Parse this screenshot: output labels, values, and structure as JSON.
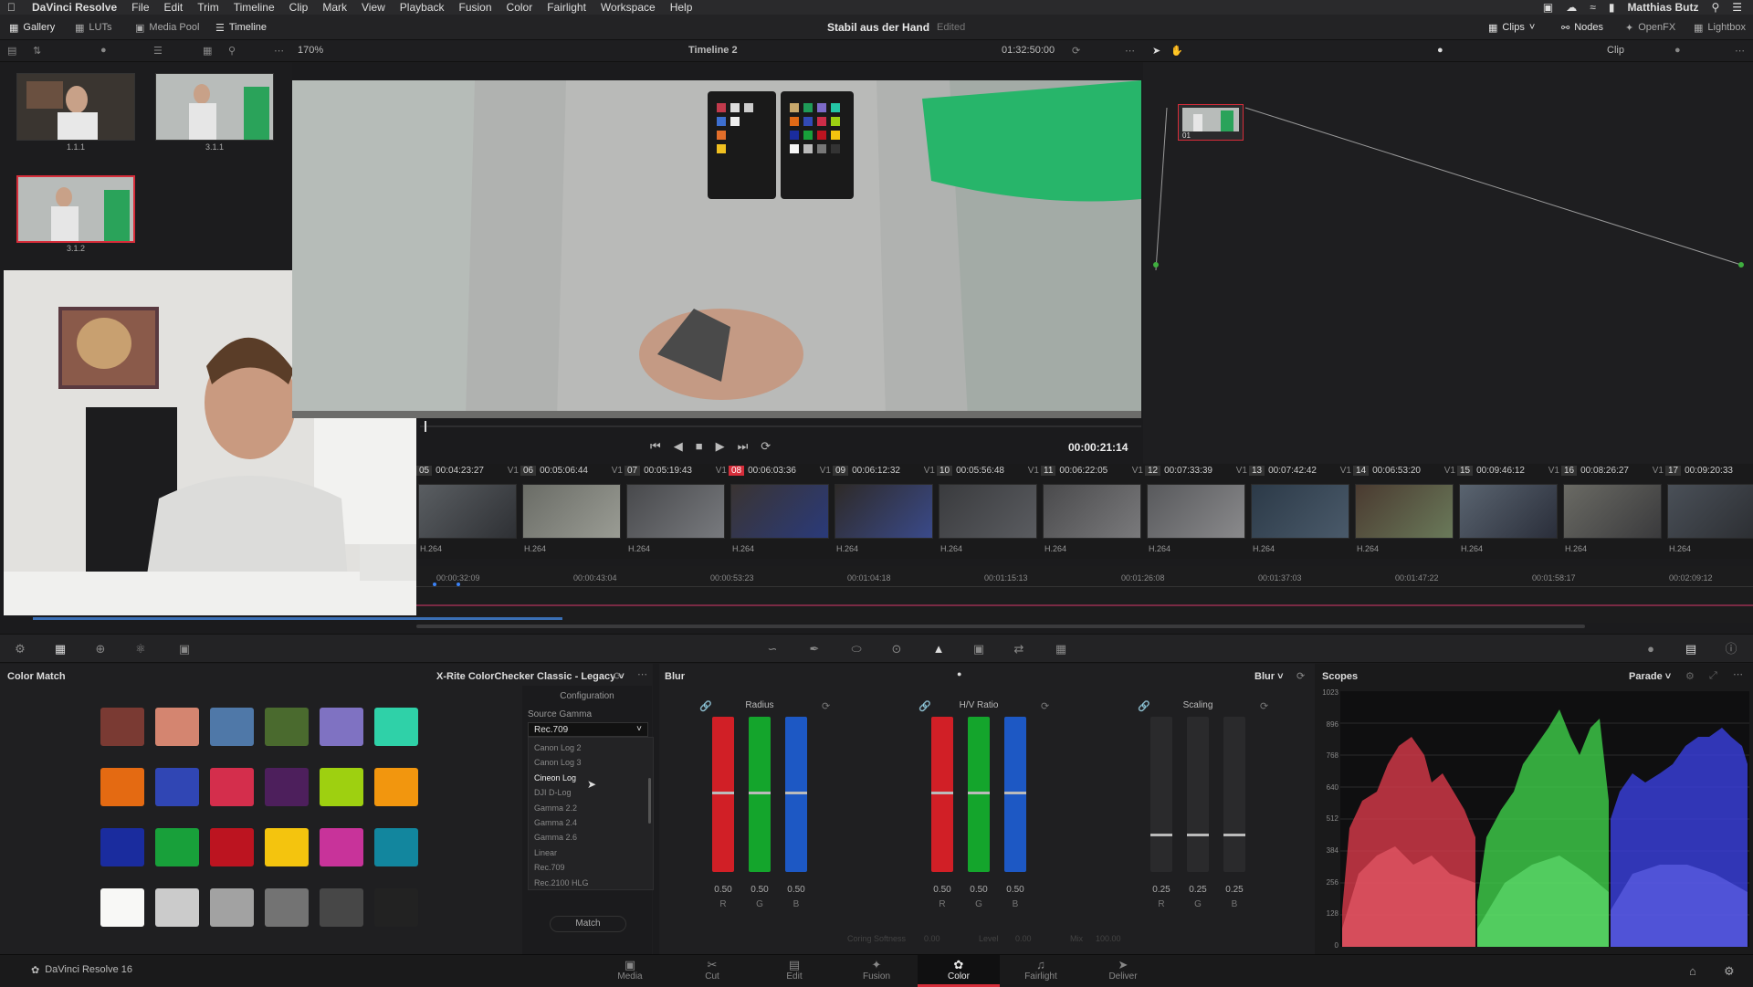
{
  "menubar": {
    "app": "DaVinci Resolve",
    "items": [
      "File",
      "Edit",
      "Trim",
      "Timeline",
      "Clip",
      "Mark",
      "View",
      "Playback",
      "Fusion",
      "Color",
      "Fairlight",
      "Workspace",
      "Help"
    ],
    "user": "Matthias Butz"
  },
  "toolbar": {
    "gallery": "Gallery",
    "luts": "LUTs",
    "media_pool": "Media Pool",
    "timeline": "Timeline",
    "project_title": "Stabil aus der Hand",
    "project_state": "Edited",
    "clips": "Clips",
    "nodes": "Nodes",
    "openfx": "OpenFX",
    "lightbox": "Lightbox"
  },
  "viewer": {
    "zoom": "170%",
    "timeline_name": "Timeline 2",
    "timecode_top": "01:32:50:00",
    "mode": "Clip",
    "timecode_current": "00:00:21:14"
  },
  "gallery": {
    "stills": [
      {
        "label": "1.1.1"
      },
      {
        "label": "3.1.1"
      },
      {
        "label": "3.1.2"
      }
    ]
  },
  "node_editor": {
    "node_label": "01"
  },
  "clips": [
    {
      "num": "05",
      "tc": "00:04:23:27",
      "track": "V1",
      "codec": "H.264"
    },
    {
      "num": "06",
      "tc": "00:05:06:44",
      "track": "V1",
      "codec": "H.264"
    },
    {
      "num": "07",
      "tc": "00:05:19:43",
      "track": "V1",
      "codec": "H.264"
    },
    {
      "num": "08",
      "tc": "00:06:03:36",
      "track": "V1",
      "codec": "H.264"
    },
    {
      "num": "09",
      "tc": "00:06:12:32",
      "track": "V1",
      "codec": "H.264"
    },
    {
      "num": "10",
      "tc": "00:05:56:48",
      "track": "V1",
      "codec": "H.264"
    },
    {
      "num": "11",
      "tc": "00:06:22:05",
      "track": "V1",
      "codec": "H.264"
    },
    {
      "num": "12",
      "tc": "00:07:33:39",
      "track": "V1",
      "codec": "H.264"
    },
    {
      "num": "13",
      "tc": "00:07:42:42",
      "track": "V1",
      "codec": "H.264"
    },
    {
      "num": "14",
      "tc": "00:06:53:20",
      "track": "V1",
      "codec": "H.264"
    },
    {
      "num": "15",
      "tc": "00:09:46:12",
      "track": "V1",
      "codec": "H.264"
    },
    {
      "num": "16",
      "tc": "00:08:26:27",
      "track": "V1",
      "codec": "H.264"
    },
    {
      "num": "17",
      "tc": "00:09:20:33",
      "track": "V1",
      "codec": "H.264"
    }
  ],
  "ruler": [
    "00:00:32:09",
    "00:00:43:04",
    "00:00:53:23",
    "00:01:04:18",
    "00:01:15:13",
    "00:01:26:08",
    "00:01:37:03",
    "00:01:47:22",
    "00:01:58:17",
    "00:02:09:12"
  ],
  "color_match": {
    "title": "Color Match",
    "chart": "X-Rite ColorChecker Classic - Legacy",
    "swatches": [
      [
        "#7a3a33",
        "#d48570",
        "#4f78a8",
        "#4a6a2e",
        "#7f72c2",
        "#2fd1a8"
      ],
      [
        "#e46a12",
        "#3046b4",
        "#d42e4c",
        "#4d1f5c",
        "#9ed010",
        "#f2960e"
      ],
      [
        "#1a2c9e",
        "#18a03a",
        "#bc1420",
        "#f4c40e",
        "#c8339a",
        "#12869e"
      ],
      [
        "#f8f8f6",
        "#cbcbcb",
        "#a2a2a2",
        "#737373",
        "#474747",
        "#222222"
      ]
    ],
    "config_label": "Configuration",
    "source_gamma_label": "Source Gamma",
    "source_gamma_value": "Rec.709",
    "gamma_options": [
      "Canon Log 2",
      "Canon Log 3",
      "Cineon Log",
      "DJI D-Log",
      "Gamma 2.2",
      "Gamma 2.4",
      "Gamma 2.6",
      "Linear",
      "Rec.709",
      "Rec.2100 HLG"
    ],
    "match_button": "Match"
  },
  "blur": {
    "title": "Blur",
    "mode": "Blur",
    "radius_label": "Radius",
    "hv_label": "H/V Ratio",
    "scaling_label": "Scaling",
    "radius_values": [
      "0.50",
      "0.50",
      "0.50"
    ],
    "hv_values": [
      "0.50",
      "0.50",
      "0.50"
    ],
    "scaling_values": [
      "0.25",
      "0.25",
      "0.25"
    ],
    "channels": [
      "R",
      "G",
      "B"
    ],
    "coring_label": "Coring Softness",
    "coring_value": "0.00",
    "level_label": "Level",
    "level_value": "0.00",
    "mix_label": "Mix",
    "mix_value": "100.00"
  },
  "scopes": {
    "title": "Scopes",
    "mode": "Parade",
    "ticks": [
      "1023",
      "896",
      "768",
      "640",
      "512",
      "384",
      "256",
      "128",
      "0"
    ]
  },
  "pagenav": {
    "app_label": "DaVinci Resolve 16",
    "pages": [
      "Media",
      "Cut",
      "Edit",
      "Fusion",
      "Color",
      "Fairlight",
      "Deliver"
    ],
    "active": "Color"
  }
}
